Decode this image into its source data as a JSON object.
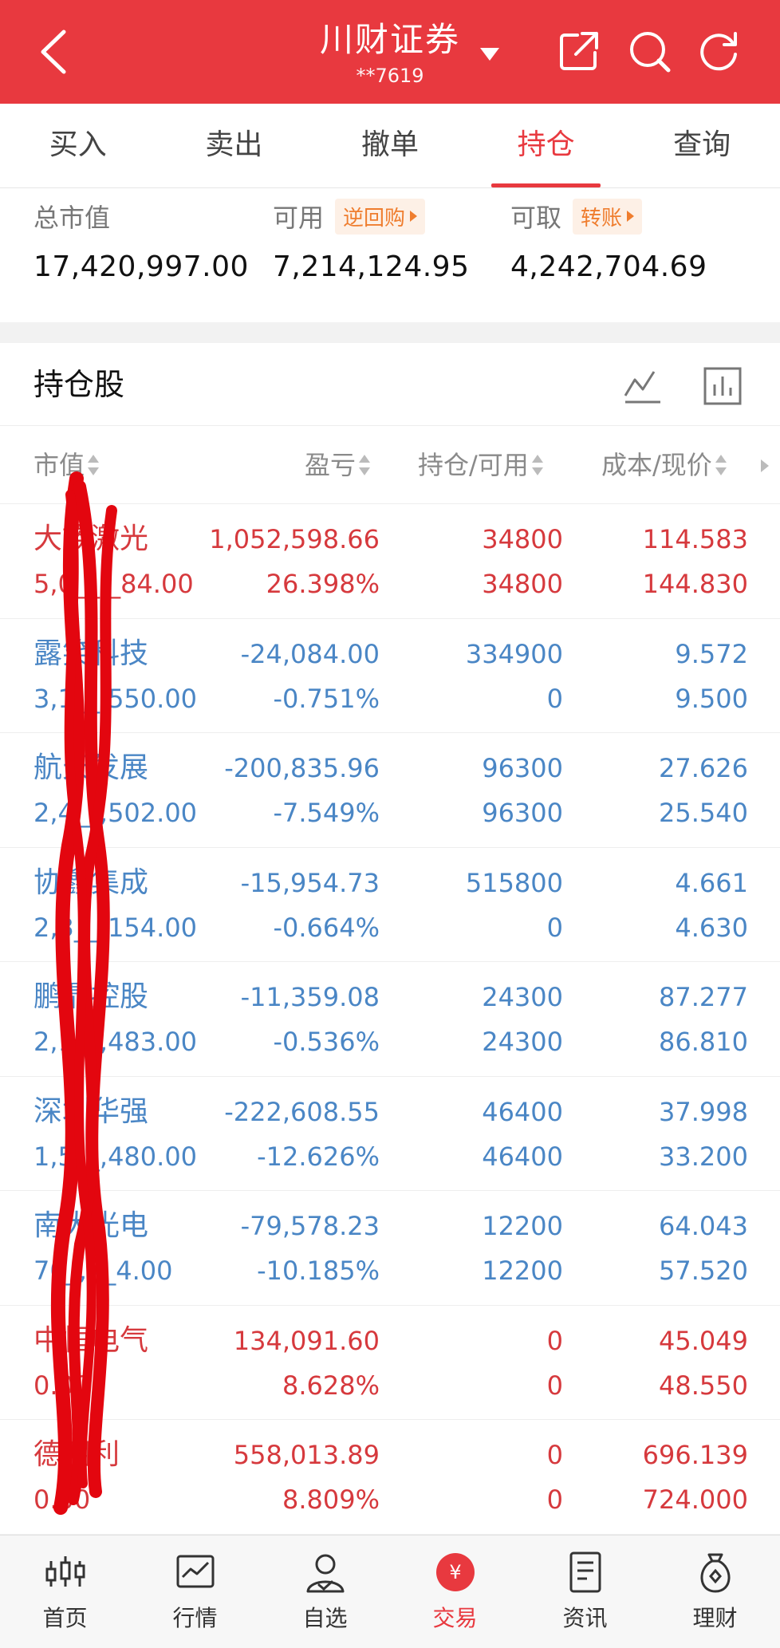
{
  "header": {
    "title": "川财证券",
    "account": "**7619"
  },
  "tabs": [
    {
      "label": "买入",
      "active": false
    },
    {
      "label": "卖出",
      "active": false
    },
    {
      "label": "撤单",
      "active": false
    },
    {
      "label": "持仓",
      "active": true
    },
    {
      "label": "查询",
      "active": false
    }
  ],
  "summary": {
    "total": {
      "label": "总市值",
      "value": "17,420,997.00"
    },
    "available": {
      "label": "可用",
      "tag": "逆回购",
      "value": "7,214,124.95"
    },
    "withdrawable": {
      "label": "可取",
      "tag": "转账",
      "value": "4,242,704.69"
    }
  },
  "holdings": {
    "title": "持仓股",
    "columns": [
      "市值",
      "盈亏",
      "持仓/可用",
      "成本/现价"
    ],
    "rows": [
      {
        "name": "大族激光",
        "market_value": "5,0__,_84.00",
        "pnl": "1,052,598.66",
        "pnl_pct": "26.398%",
        "position": "34800",
        "available": "34800",
        "cost": "114.583",
        "price": "144.830",
        "trend": "up"
      },
      {
        "name": "露笑科技",
        "market_value": "3,1__,550.00",
        "pnl": "-24,084.00",
        "pnl_pct": "-0.751%",
        "position": "334900",
        "available": "0",
        "cost": "9.572",
        "price": "9.500",
        "trend": "down"
      },
      {
        "name": "航天发展",
        "market_value": "2,4__,502.00",
        "pnl": "-200,835.96",
        "pnl_pct": "-7.549%",
        "position": "96300",
        "available": "96300",
        "cost": "27.626",
        "price": "25.540",
        "trend": "down"
      },
      {
        "name": "协鑫集成",
        "market_value": "2,3__,154.00",
        "pnl": "-15,954.73",
        "pnl_pct": "-0.664%",
        "position": "515800",
        "available": "0",
        "cost": "4.661",
        "price": "4.630",
        "trend": "down"
      },
      {
        "name": "鹏鼎控股",
        "market_value": "2,1__,483.00",
        "pnl": "-11,359.08",
        "pnl_pct": "-0.536%",
        "position": "24300",
        "available": "24300",
        "cost": "87.277",
        "price": "86.810",
        "trend": "down"
      },
      {
        "name": "深圳华强",
        "market_value": "1,5__,480.00",
        "pnl": "-222,608.55",
        "pnl_pct": "-12.626%",
        "position": "46400",
        "available": "46400",
        "cost": "37.998",
        "price": "33.200",
        "trend": "down"
      },
      {
        "name": "南大光电",
        "market_value": "70_,7_4.00",
        "pnl": "-79,578.23",
        "pnl_pct": "-10.185%",
        "position": "12200",
        "available": "12200",
        "cost": "64.043",
        "price": "57.520",
        "trend": "down"
      },
      {
        "name": "中恒电气",
        "market_value": "0.00",
        "pnl": "134,091.60",
        "pnl_pct": "8.628%",
        "position": "0",
        "available": "0",
        "cost": "45.049",
        "price": "48.550",
        "trend": "up"
      },
      {
        "name": "德明利",
        "market_value": "0.00",
        "pnl": "558,013.89",
        "pnl_pct": "8.809%",
        "position": "0",
        "available": "0",
        "cost": "696.139",
        "price": "724.000",
        "trend": "up"
      }
    ]
  },
  "bottom_nav": [
    {
      "label": "首页",
      "icon": "kline-icon",
      "active": false
    },
    {
      "label": "行情",
      "icon": "chart-icon",
      "active": false
    },
    {
      "label": "自选",
      "icon": "user-check-icon",
      "active": false
    },
    {
      "label": "交易",
      "icon": "yen-icon",
      "active": true
    },
    {
      "label": "资讯",
      "icon": "news-icon",
      "active": false
    },
    {
      "label": "理财",
      "icon": "money-bag-icon",
      "active": false
    }
  ],
  "colors": {
    "brand": "#e8393f",
    "gain": "#d6393d",
    "loss": "#4a86c5",
    "tag": "#ef7d2e"
  }
}
